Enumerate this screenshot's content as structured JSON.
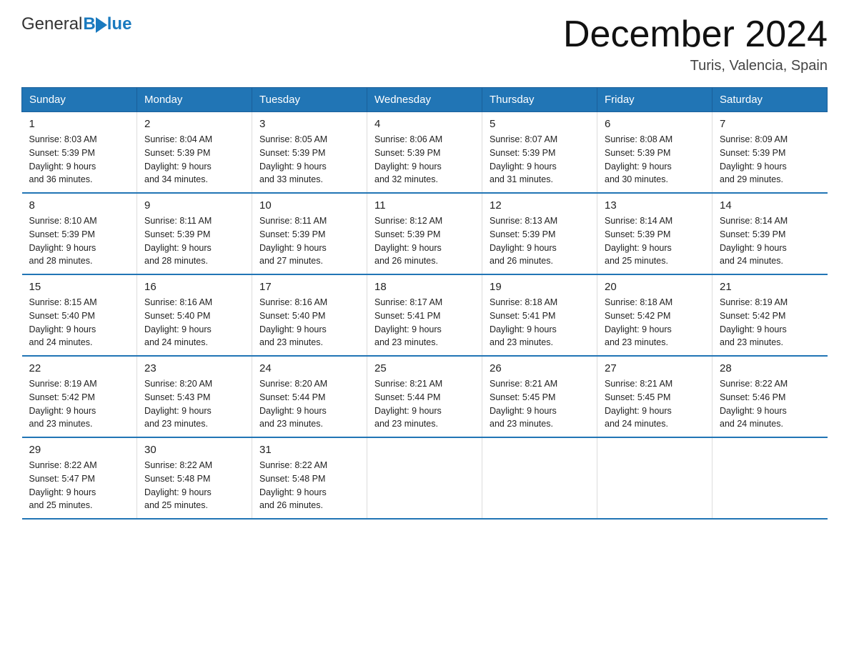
{
  "header": {
    "logo_general": "General",
    "logo_blue": "Blue",
    "title": "December 2024",
    "subtitle": "Turis, Valencia, Spain"
  },
  "days_of_week": [
    "Sunday",
    "Monday",
    "Tuesday",
    "Wednesday",
    "Thursday",
    "Friday",
    "Saturday"
  ],
  "weeks": [
    [
      {
        "day": "1",
        "sunrise": "8:03 AM",
        "sunset": "5:39 PM",
        "daylight": "9 hours and 36 minutes."
      },
      {
        "day": "2",
        "sunrise": "8:04 AM",
        "sunset": "5:39 PM",
        "daylight": "9 hours and 34 minutes."
      },
      {
        "day": "3",
        "sunrise": "8:05 AM",
        "sunset": "5:39 PM",
        "daylight": "9 hours and 33 minutes."
      },
      {
        "day": "4",
        "sunrise": "8:06 AM",
        "sunset": "5:39 PM",
        "daylight": "9 hours and 32 minutes."
      },
      {
        "day": "5",
        "sunrise": "8:07 AM",
        "sunset": "5:39 PM",
        "daylight": "9 hours and 31 minutes."
      },
      {
        "day": "6",
        "sunrise": "8:08 AM",
        "sunset": "5:39 PM",
        "daylight": "9 hours and 30 minutes."
      },
      {
        "day": "7",
        "sunrise": "8:09 AM",
        "sunset": "5:39 PM",
        "daylight": "9 hours and 29 minutes."
      }
    ],
    [
      {
        "day": "8",
        "sunrise": "8:10 AM",
        "sunset": "5:39 PM",
        "daylight": "9 hours and 28 minutes."
      },
      {
        "day": "9",
        "sunrise": "8:11 AM",
        "sunset": "5:39 PM",
        "daylight": "9 hours and 28 minutes."
      },
      {
        "day": "10",
        "sunrise": "8:11 AM",
        "sunset": "5:39 PM",
        "daylight": "9 hours and 27 minutes."
      },
      {
        "day": "11",
        "sunrise": "8:12 AM",
        "sunset": "5:39 PM",
        "daylight": "9 hours and 26 minutes."
      },
      {
        "day": "12",
        "sunrise": "8:13 AM",
        "sunset": "5:39 PM",
        "daylight": "9 hours and 26 minutes."
      },
      {
        "day": "13",
        "sunrise": "8:14 AM",
        "sunset": "5:39 PM",
        "daylight": "9 hours and 25 minutes."
      },
      {
        "day": "14",
        "sunrise": "8:14 AM",
        "sunset": "5:39 PM",
        "daylight": "9 hours and 24 minutes."
      }
    ],
    [
      {
        "day": "15",
        "sunrise": "8:15 AM",
        "sunset": "5:40 PM",
        "daylight": "9 hours and 24 minutes."
      },
      {
        "day": "16",
        "sunrise": "8:16 AM",
        "sunset": "5:40 PM",
        "daylight": "9 hours and 24 minutes."
      },
      {
        "day": "17",
        "sunrise": "8:16 AM",
        "sunset": "5:40 PM",
        "daylight": "9 hours and 23 minutes."
      },
      {
        "day": "18",
        "sunrise": "8:17 AM",
        "sunset": "5:41 PM",
        "daylight": "9 hours and 23 minutes."
      },
      {
        "day": "19",
        "sunrise": "8:18 AM",
        "sunset": "5:41 PM",
        "daylight": "9 hours and 23 minutes."
      },
      {
        "day": "20",
        "sunrise": "8:18 AM",
        "sunset": "5:42 PM",
        "daylight": "9 hours and 23 minutes."
      },
      {
        "day": "21",
        "sunrise": "8:19 AM",
        "sunset": "5:42 PM",
        "daylight": "9 hours and 23 minutes."
      }
    ],
    [
      {
        "day": "22",
        "sunrise": "8:19 AM",
        "sunset": "5:42 PM",
        "daylight": "9 hours and 23 minutes."
      },
      {
        "day": "23",
        "sunrise": "8:20 AM",
        "sunset": "5:43 PM",
        "daylight": "9 hours and 23 minutes."
      },
      {
        "day": "24",
        "sunrise": "8:20 AM",
        "sunset": "5:44 PM",
        "daylight": "9 hours and 23 minutes."
      },
      {
        "day": "25",
        "sunrise": "8:21 AM",
        "sunset": "5:44 PM",
        "daylight": "9 hours and 23 minutes."
      },
      {
        "day": "26",
        "sunrise": "8:21 AM",
        "sunset": "5:45 PM",
        "daylight": "9 hours and 23 minutes."
      },
      {
        "day": "27",
        "sunrise": "8:21 AM",
        "sunset": "5:45 PM",
        "daylight": "9 hours and 24 minutes."
      },
      {
        "day": "28",
        "sunrise": "8:22 AM",
        "sunset": "5:46 PM",
        "daylight": "9 hours and 24 minutes."
      }
    ],
    [
      {
        "day": "29",
        "sunrise": "8:22 AM",
        "sunset": "5:47 PM",
        "daylight": "9 hours and 25 minutes."
      },
      {
        "day": "30",
        "sunrise": "8:22 AM",
        "sunset": "5:48 PM",
        "daylight": "9 hours and 25 minutes."
      },
      {
        "day": "31",
        "sunrise": "8:22 AM",
        "sunset": "5:48 PM",
        "daylight": "9 hours and 26 minutes."
      },
      null,
      null,
      null,
      null
    ]
  ],
  "labels": {
    "sunrise": "Sunrise:",
    "sunset": "Sunset:",
    "daylight": "Daylight:"
  }
}
